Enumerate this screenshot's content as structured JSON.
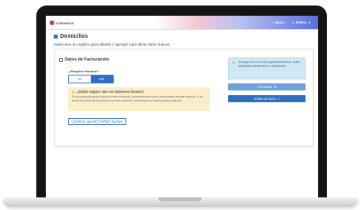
{
  "header": {
    "logo_text": "CORHAVIS",
    "nav": [
      {
        "label": "INICIO",
        "icon": "home-icon"
      },
      {
        "label": "PERFIL",
        "icon": "user-icon"
      }
    ]
  },
  "page": {
    "title": "Domicilios",
    "subtitle": "Seleccione un registro para editarlo o 'agregar' para llenar datos nuevos."
  },
  "form": {
    "title": "Datos de Facturación",
    "question": "¿Requiere Factura?",
    "options": [
      "SI",
      "NO"
    ],
    "selected": "NO",
    "warning": {
      "title": "¿Estás seguro que no requieres factura?",
      "text": "Si no proporcionas tus datos en este momento, posteriormente ya no será posible solicitar factura. Si no tienes los datos de facturación en este momento, contáctanos y regresa para continuar."
    },
    "confirm_label": "Confirmo que NO (SI/NO) factura"
  },
  "side": {
    "info_text": "Al llegar clic en el botón guardar/continuar, estás aceptando los términos y condiciones.",
    "continue_label": "Continuar",
    "back_label": "Volver al inicio"
  },
  "colors": {
    "primary": "#2d6fc0",
    "primary_light": "#6ea1d8",
    "warning_bg": "#fbeec8",
    "info_bg": "#cfe8f3"
  }
}
